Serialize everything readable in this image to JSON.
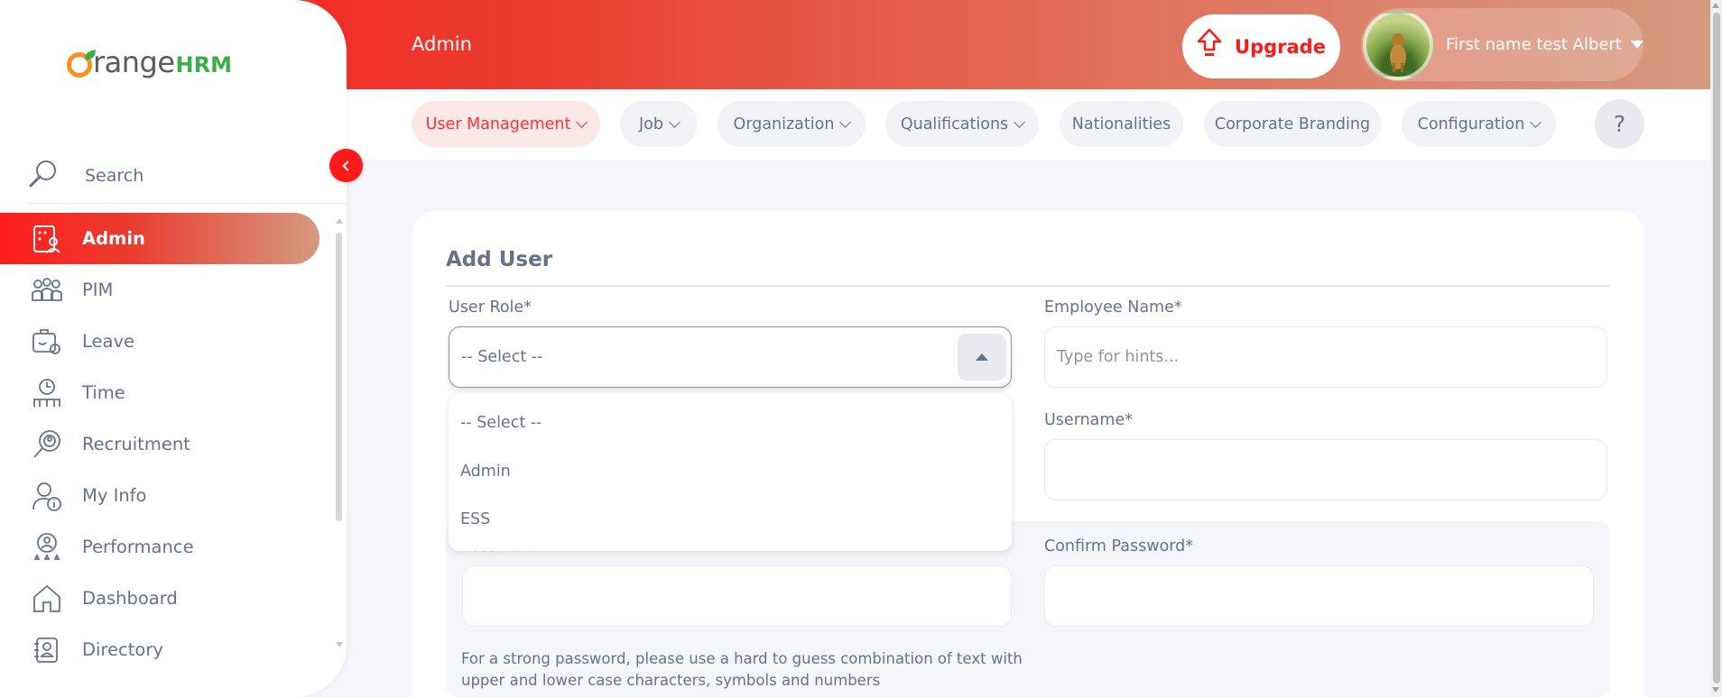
{
  "header": {
    "page_title": "Admin",
    "upgrade_label": "Upgrade",
    "user_name": "First name test Albert"
  },
  "brand": {
    "logo_main": "range",
    "logo_suffix": "HRM"
  },
  "nav": {
    "tabs": [
      {
        "label": "User Management",
        "active": true,
        "has_dropdown": true
      },
      {
        "label": "Job",
        "active": false,
        "has_dropdown": true
      },
      {
        "label": "Organization",
        "active": false,
        "has_dropdown": true
      },
      {
        "label": "Qualifications",
        "active": false,
        "has_dropdown": true
      },
      {
        "label": "Nationalities",
        "active": false,
        "has_dropdown": false
      },
      {
        "label": "Corporate Branding",
        "active": false,
        "has_dropdown": false
      },
      {
        "label": "Configuration",
        "active": false,
        "has_dropdown": true
      }
    ],
    "help_label": "?"
  },
  "sidebar": {
    "search_label": "Search",
    "items": [
      {
        "label": "Admin",
        "icon": "admin-icon",
        "active": true
      },
      {
        "label": "PIM",
        "icon": "pim-icon",
        "active": false
      },
      {
        "label": "Leave",
        "icon": "leave-icon",
        "active": false
      },
      {
        "label": "Time",
        "icon": "time-icon",
        "active": false
      },
      {
        "label": "Recruitment",
        "icon": "recruitment-icon",
        "active": false
      },
      {
        "label": "My Info",
        "icon": "my-info-icon",
        "active": false
      },
      {
        "label": "Performance",
        "icon": "performance-icon",
        "active": false
      },
      {
        "label": "Dashboard",
        "icon": "dashboard-icon",
        "active": false
      },
      {
        "label": "Directory",
        "icon": "directory-icon",
        "active": false
      }
    ]
  },
  "form": {
    "title": "Add User",
    "user_role": {
      "label": "User Role*",
      "value": "-- Select --",
      "options": [
        "-- Select --",
        "Admin",
        "ESS"
      ]
    },
    "employee_name": {
      "label": "Employee Name*",
      "placeholder": "Type for hints..."
    },
    "username": {
      "label": "Username*",
      "value": ""
    },
    "password": {
      "label": "Password",
      "value": ""
    },
    "confirm_password": {
      "label": "Confirm Password*",
      "value": ""
    },
    "password_hint": "For a strong password, please use a hard to guess combination of text with upper and lower case characters, symbols and numbers"
  },
  "colors": {
    "accent": "#ff1a1a",
    "text": "#64728c",
    "active_tab_bg": "#fde8e8"
  }
}
